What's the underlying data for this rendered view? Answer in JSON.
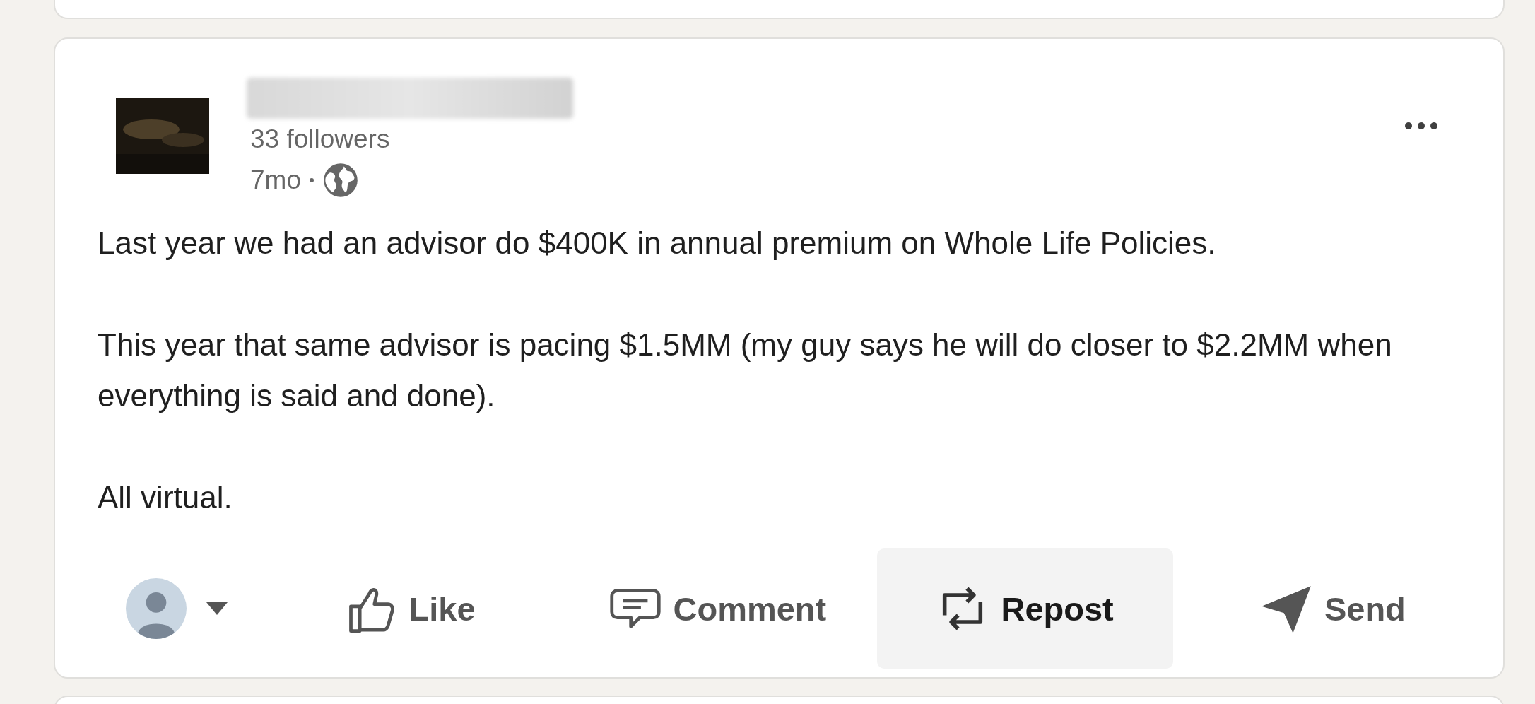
{
  "post": {
    "author": {
      "followers": "33 followers"
    },
    "time": "7mo",
    "paragraphs": [
      "Last year we had an advisor do $400K in annual premium on Whole Life Policies.",
      "This year that same advisor is pacing $1.5MM (my guy says he will do closer to $2.2MM when everything is said and done).",
      "All virtual."
    ]
  },
  "actions": [
    {
      "kind": "like",
      "label": "Like",
      "highlighted": false
    },
    {
      "kind": "comment",
      "label": "Comment",
      "highlighted": false
    },
    {
      "kind": "repost",
      "label": "Repost",
      "highlighted": true
    },
    {
      "kind": "send",
      "label": "Send",
      "highlighted": false
    }
  ]
}
